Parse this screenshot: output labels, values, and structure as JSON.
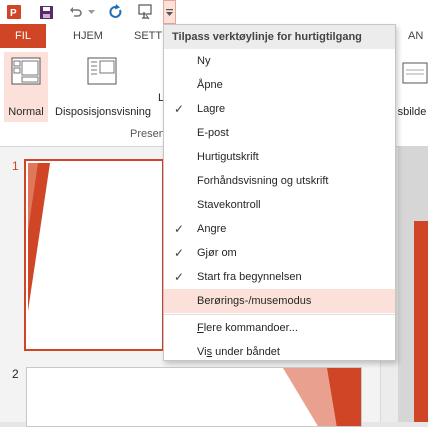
{
  "tabs": {
    "fil": "FIL",
    "hjem": "HJEM",
    "sett": "SETT",
    "an": "AN"
  },
  "ribbon": {
    "normal_label": "Normal",
    "disposisjon_label": "Disposisjonsvisning",
    "partial_label": "L",
    "right_label": "sbilde",
    "group_label": "Presen"
  },
  "slides": {
    "one": "1",
    "two": "2"
  },
  "menu": {
    "header": "Tilpass verktøylinje for hurtigtilgang",
    "items": [
      {
        "label": "Ny",
        "checked": false
      },
      {
        "label": "Åpne",
        "checked": false
      },
      {
        "label": "Lagre",
        "checked": true
      },
      {
        "label": "E-post",
        "checked": false
      },
      {
        "label": "Hurtigutskrift",
        "checked": false
      },
      {
        "label": "Forhåndsvisning og utskrift",
        "checked": false
      },
      {
        "label": "Stavekontroll",
        "checked": false
      },
      {
        "label": "Angre",
        "checked": true
      },
      {
        "label": "Gjør om",
        "checked": true
      },
      {
        "label": "Start fra begynnelsen",
        "checked": true
      },
      {
        "label": "Berørings-/musemodus",
        "checked": false,
        "highlighted": true
      }
    ],
    "more_first": "F",
    "more_rest": "lere kommandoer...",
    "show_first": "Vi",
    "show_u": "s",
    "show_rest": " under båndet",
    "check_glyph": "✓"
  },
  "colors": {
    "accent": "#d04525",
    "highlight": "#fbe1d9"
  }
}
